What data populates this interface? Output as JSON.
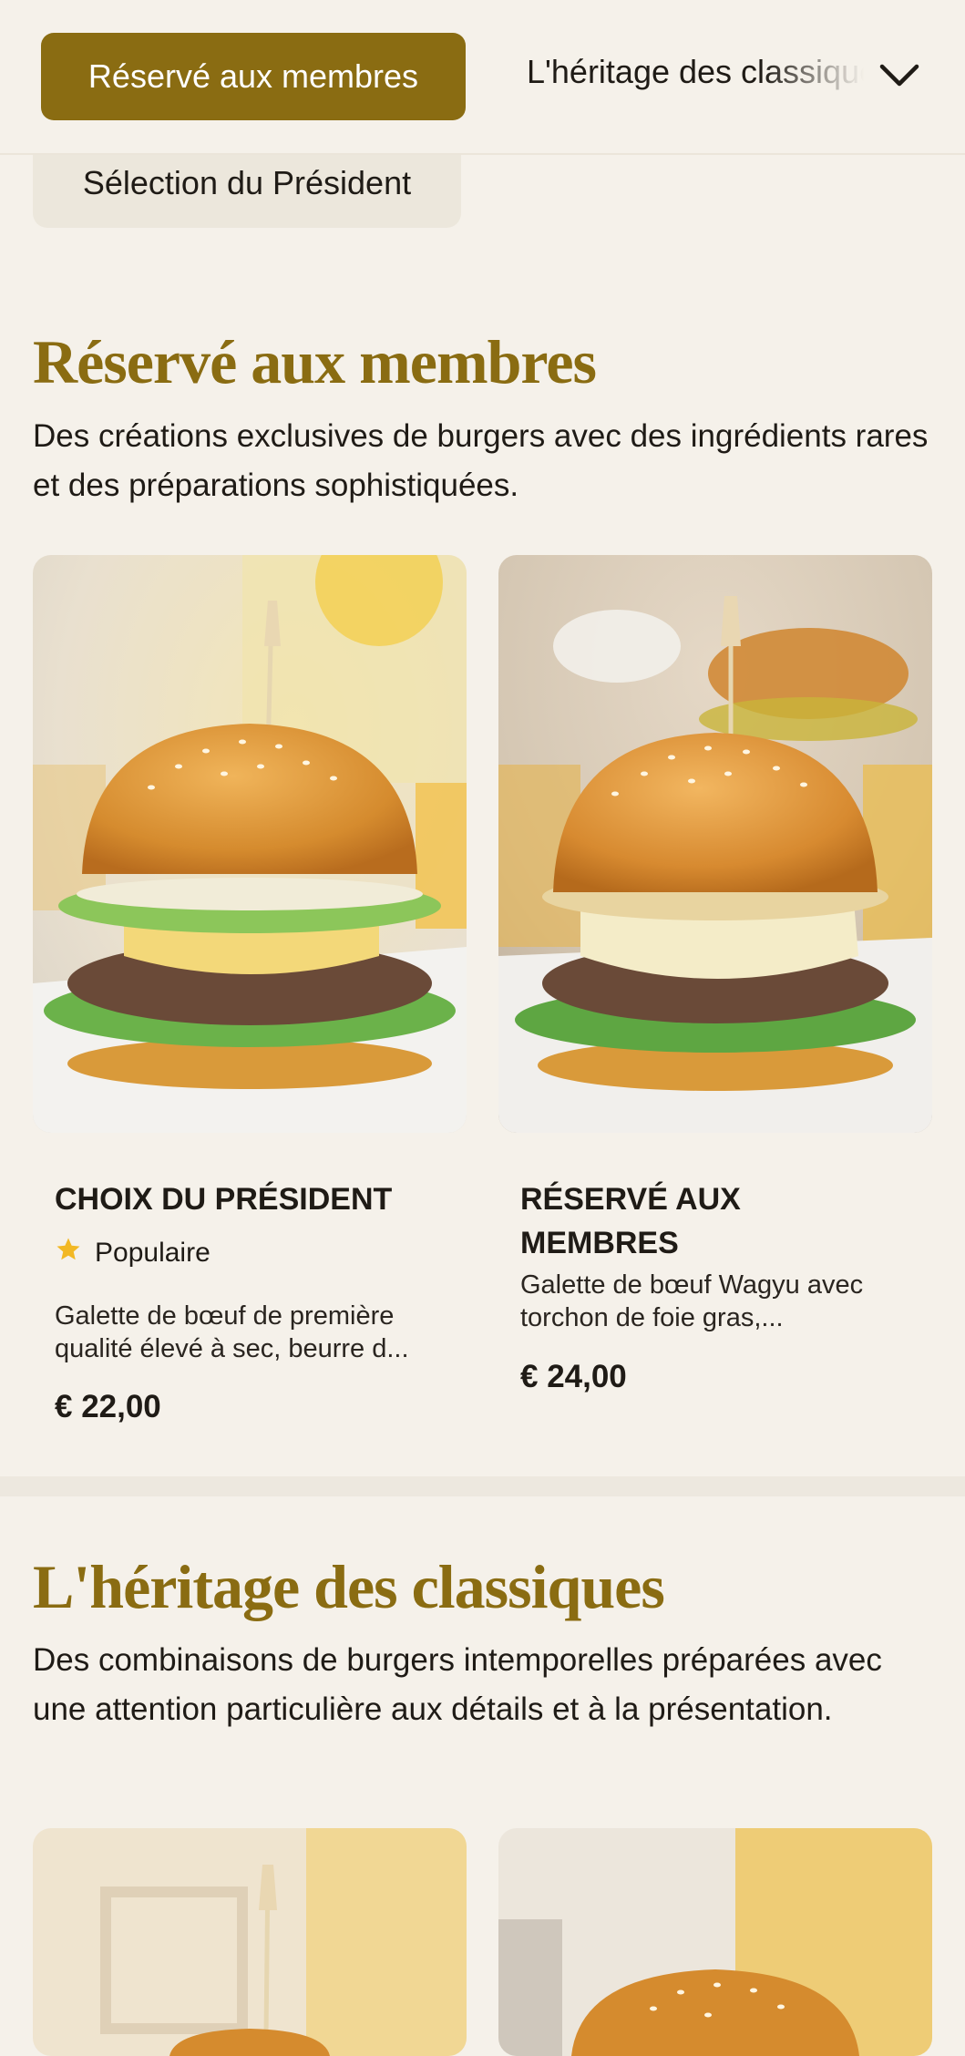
{
  "nav": {
    "active_category": "Réservé aux membres",
    "next_category": "L'héritage des classiques",
    "previous_category": "Sélection du Président"
  },
  "sections": [
    {
      "title": "Réservé aux membres",
      "description": "Des créations exclusives de burgers avec des ingrédients rares et des préparations sophistiquées.",
      "items": [
        {
          "name": "CHOIX DU PRÉSIDENT",
          "badge": "Populaire",
          "description": "Galette de bœuf de première qualité élevé à sec, beurre d...",
          "price": "€ 22,00"
        },
        {
          "name": "RÉSERVÉ AUX MEMBRES",
          "description": "Galette de bœuf Wagyu avec torchon de foie gras,...",
          "price": "€ 24,00"
        }
      ]
    },
    {
      "title": "L'héritage des classiques",
      "description": "Des combinaisons de burgers intemporelles préparées avec une attention particulière aux détails et à la présentation."
    }
  ],
  "icons": {
    "dropdown": "chevron-down-icon",
    "badge": "star-icon"
  },
  "colors": {
    "accent": "#8a6c12",
    "background": "#f5f1ea",
    "star": "#f2b824"
  }
}
